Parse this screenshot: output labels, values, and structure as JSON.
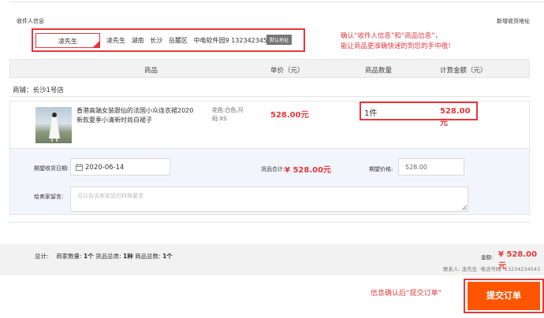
{
  "recipient": {
    "section_label": "收件人信息",
    "add_address_link": "新增收货地址",
    "selected_name": "凌先生",
    "detail_name": "凌先生",
    "province": "湖南",
    "city": "长沙",
    "district": "岳麓区",
    "address": "中电软件园9",
    "phone": "13234234543",
    "default_badge": "默认地址"
  },
  "annotation_top": {
    "line1": "确认“收件人信息”和“商品信息”，",
    "line2": "能让商品更准确快速的到您的手中哦！"
  },
  "table_header": {
    "product": "商品",
    "unit_price": "单价（元）",
    "quantity": "商品数量",
    "total": "计算金额（元）"
  },
  "shop": {
    "label": "商铺：长沙1号店"
  },
  "item": {
    "title_line1": "香港高端女装跟仙的法国小众连衣裙2020",
    "title_line2": "新款夏季小清新时尚白裙子",
    "attr_line1": "花色:白色,尺",
    "attr_line2": "码:XS",
    "price": "528.00元",
    "quantity": "1件",
    "total": "528.00元"
  },
  "order_form": {
    "delivery_date_label": "期望收货日期:",
    "delivery_date_value": "2020-06-14",
    "subtotal_label": "货品合计:",
    "subtotal_value": "¥ 528.00元",
    "expected_price_label": "期望价格:",
    "expected_price_value": "528.00",
    "message_label": "给卖家留言:",
    "message_placeholder": "可以告诉卖家您的特殊要求"
  },
  "summary": {
    "total_label": "总计:",
    "merchant_count_label": "商家数量:",
    "merchant_count": "1个",
    "category_label": "货品总类:",
    "category_count": "1种",
    "item_count_label": "商品总数:",
    "item_count": "1个",
    "amount_label": "金额:",
    "amount_value": "¥ 528.00元",
    "contact_label": "联系人:",
    "contact_name": "凌先生",
    "phone_label": "电话号码:",
    "phone_value": "13234234543"
  },
  "submit": {
    "hint": "信息确认后“提交订单”",
    "button_label": "提交订单"
  },
  "colors": {
    "accent": "#ff5500",
    "annotation": "#e4393c"
  },
  "icons": {
    "calendar": "calendar-icon",
    "check": "check-corner-icon",
    "product_image": "dress-product-image"
  }
}
